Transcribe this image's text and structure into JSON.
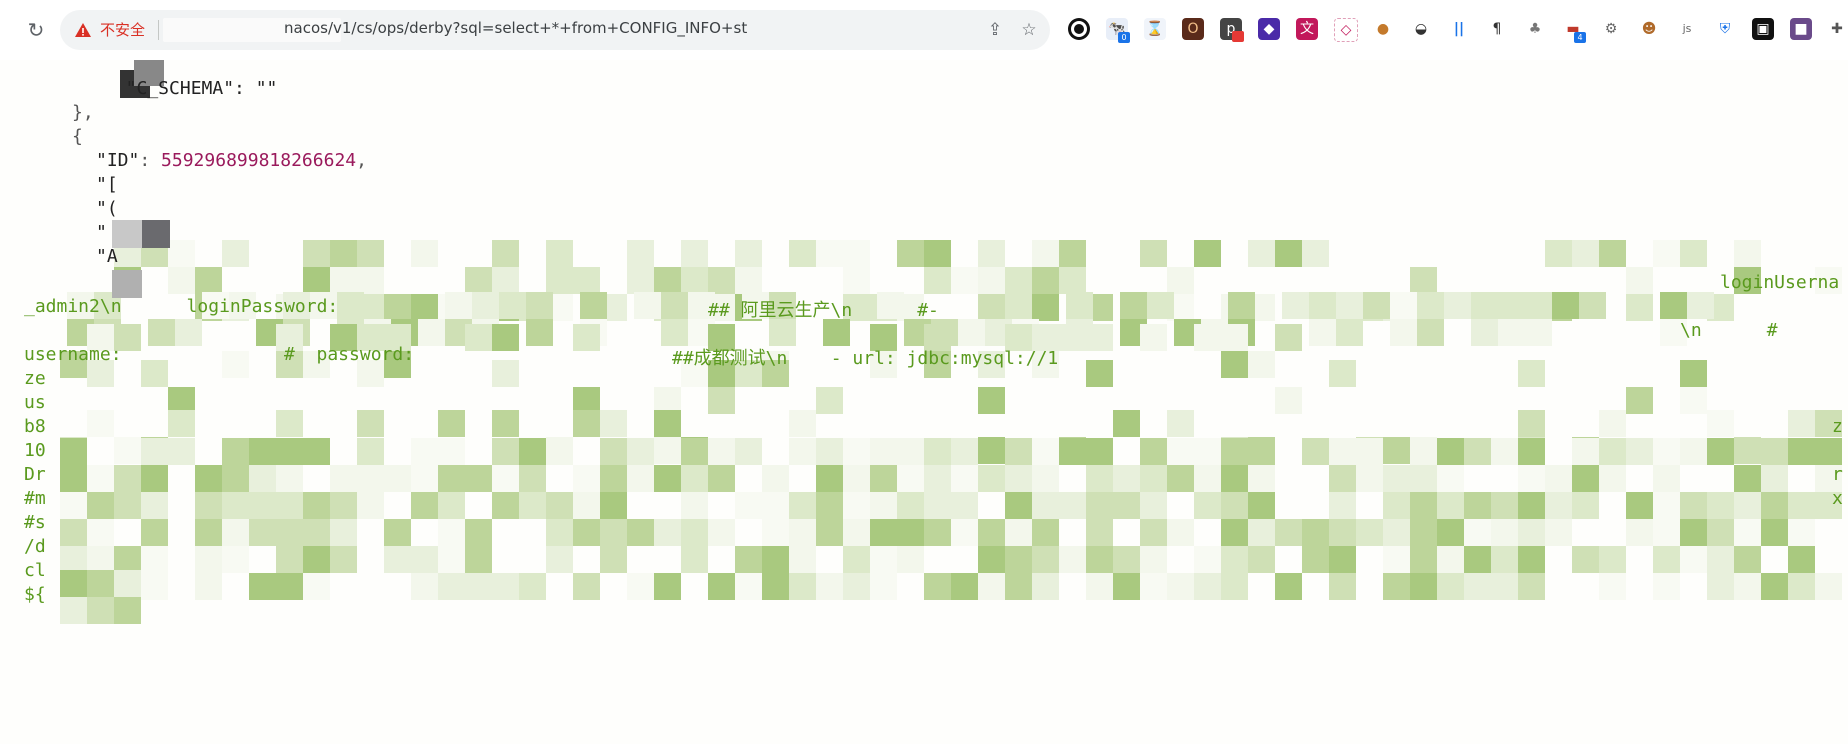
{
  "browser": {
    "security_label": "不安全",
    "url_text": "nacos/v1/cs/ops/derby?sql=select+*+from+CONFIG_INFO+st"
  },
  "extensions": {
    "badge_1": "0",
    "badge_2": "4"
  },
  "json_view": {
    "line_schema": "  \"C_SCHEMA\": \"\"",
    "line_close": "},",
    "line_open": "{",
    "id_key": "\"ID\"",
    "id_colon": ": ",
    "id_value": "559296899818266624",
    "id_comma": ",",
    "line_trunc_1": "\"[",
    "line_trunc_2": "\"(",
    "line_trunc_3": "\"",
    "line_trunc_4": "\"A",
    "content_1": "loginUserna",
    "content_2a": "_admin2\\n      loginPassword: ",
    "content_2b": "## 阿里云生产\\n      #- ",
    "content_3": "                    #",
    "content_4a": "username:",
    "content_4b": "#  password:",
    "content_4c": "##成都测试\\n    - url: jdbc:mysql://1",
    "content_5": "ze",
    "content_6": "us",
    "content_7": "b8",
    "content_8": "10",
    "content_9": "Dr",
    "content_10": "#m",
    "content_11": "#s",
    "content_12": "/d",
    "content_13": "cl",
    "content_14": "${",
    "edge_1": "\\n      #",
    "edge_2": "z",
    "edge_3": "x",
    "edge_4": "r"
  }
}
